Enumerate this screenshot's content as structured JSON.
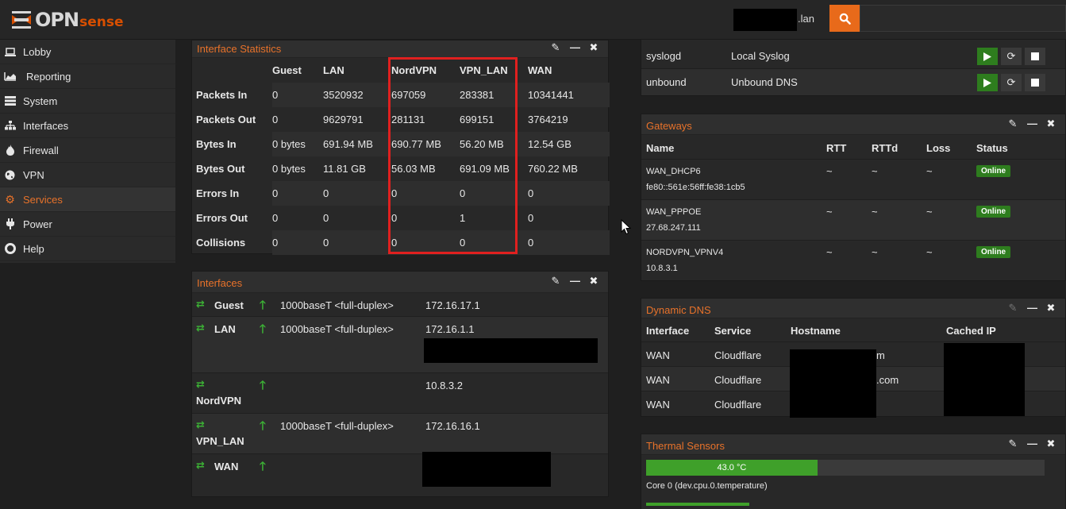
{
  "app": {
    "brand_main": "OPN",
    "brand_accent": "sense",
    "hostname_suffix": ".lan",
    "accent_color": "#e8722a"
  },
  "search": {
    "placeholder": ""
  },
  "sidebar": {
    "items": [
      {
        "label": "Lobby",
        "icon": "laptop-icon"
      },
      {
        "label": "Reporting",
        "icon": "area-chart-icon"
      },
      {
        "label": "System",
        "icon": "server-icon"
      },
      {
        "label": "Interfaces",
        "icon": "sitemap-icon"
      },
      {
        "label": "Firewall",
        "icon": "fire-icon"
      },
      {
        "label": "VPN",
        "icon": "globe-icon"
      },
      {
        "label": "Services",
        "icon": "cog-icon"
      },
      {
        "label": "Power",
        "icon": "plug-icon"
      },
      {
        "label": "Help",
        "icon": "lifebuoy-icon"
      }
    ]
  },
  "iface_stats": {
    "title": "Interface Statistics",
    "columns": [
      "",
      "Guest",
      "LAN",
      "NordVPN",
      "VPN_LAN",
      "WAN"
    ],
    "rows": [
      [
        "Packets In",
        "0",
        "3520932",
        "697059",
        "283381",
        "10341441"
      ],
      [
        "Packets Out",
        "0",
        "9629791",
        "281131",
        "699151",
        "3764219"
      ],
      [
        "Bytes In",
        "0 bytes",
        "691.94 MB",
        "690.77 MB",
        "56.20 MB",
        "12.54 GB"
      ],
      [
        "Bytes Out",
        "0 bytes",
        "11.81 GB",
        "56.03 MB",
        "691.09 MB",
        "760.22 MB"
      ],
      [
        "Errors In",
        "0",
        "0",
        "0",
        "0",
        "0"
      ],
      [
        "Errors Out",
        "0",
        "0",
        "0",
        "1",
        "0"
      ],
      [
        "Collisions",
        "0",
        "0",
        "0",
        "0",
        "0"
      ]
    ]
  },
  "interfaces": {
    "title": "Interfaces",
    "items": [
      {
        "name": "Guest",
        "media": "1000baseT <full-duplex>",
        "ip": "172.16.17.1"
      },
      {
        "name": "LAN",
        "media": "1000baseT <full-duplex>",
        "ip": "172.16.1.1"
      },
      {
        "name": "NordVPN",
        "media": "",
        "ip": "10.8.3.2"
      },
      {
        "name": "VPN_LAN",
        "media": "1000baseT <full-duplex>",
        "ip": "172.16.16.1"
      },
      {
        "name": "WAN",
        "media": "",
        "ip": ""
      }
    ]
  },
  "services": {
    "items": [
      {
        "name": "syslogd",
        "desc": "Local Syslog"
      },
      {
        "name": "unbound",
        "desc": "Unbound DNS"
      }
    ]
  },
  "gateways": {
    "title": "Gateways",
    "columns": [
      "Name",
      "RTT",
      "RTTd",
      "Loss",
      "Status"
    ],
    "rows": [
      {
        "name": "WAN_DHCP6",
        "addr": "fe80::561e:56ff:fe38:1cb5",
        "rtt": "~",
        "rttd": "~",
        "loss": "~",
        "status": "Online"
      },
      {
        "name": "WAN_PPPOE",
        "addr": "27.68.247.111",
        "rtt": "~",
        "rttd": "~",
        "loss": "~",
        "status": "Online"
      },
      {
        "name": "NORDVPN_VPNV4",
        "addr": "10.8.3.1",
        "rtt": "~",
        "rttd": "~",
        "loss": "~",
        "status": "Online"
      }
    ]
  },
  "ddns": {
    "title": "Dynamic DNS",
    "columns": [
      "Interface",
      "Service",
      "Hostname",
      "Cached IP"
    ],
    "rows": [
      {
        "iface": "WAN",
        "service": "Cloudflare",
        "host_tail": "m"
      },
      {
        "iface": "WAN",
        "service": "Cloudflare",
        "host_tail": ".com"
      },
      {
        "iface": "WAN",
        "service": "Cloudflare",
        "host_tail": ""
      }
    ]
  },
  "thermal": {
    "title": "Thermal Sensors",
    "reading": "43.0 °C",
    "fraction": 0.43,
    "label": "Core 0 (dev.cpu.0.temperature)"
  }
}
